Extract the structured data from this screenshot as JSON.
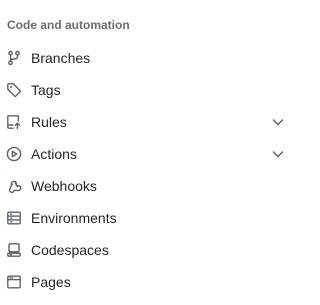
{
  "section": {
    "heading": "Code and automation",
    "items": [
      {
        "label": "Branches",
        "icon": "git-branch-icon",
        "expandable": false
      },
      {
        "label": "Tags",
        "icon": "tag-icon",
        "expandable": false
      },
      {
        "label": "Rules",
        "icon": "repo-push-icon",
        "expandable": true
      },
      {
        "label": "Actions",
        "icon": "play-icon",
        "expandable": true
      },
      {
        "label": "Webhooks",
        "icon": "webhook-icon",
        "expandable": false
      },
      {
        "label": "Environments",
        "icon": "server-icon",
        "expandable": false
      },
      {
        "label": "Codespaces",
        "icon": "codespaces-icon",
        "expandable": false
      },
      {
        "label": "Pages",
        "icon": "browser-icon",
        "expandable": false
      }
    ]
  },
  "colors": {
    "text": "#1f2328",
    "heading": "#656d76",
    "icon": "#59636e",
    "background": "#ffffff"
  }
}
